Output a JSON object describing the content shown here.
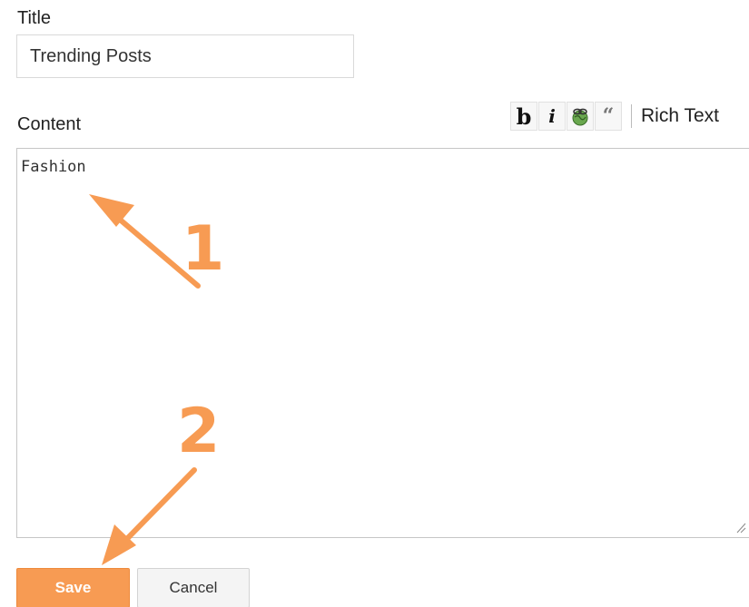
{
  "form": {
    "title_label": "Title",
    "title_value": "Trending Posts",
    "content_label": "Content",
    "content_value": "Fashion"
  },
  "toolbar": {
    "bold": "b",
    "italic": "i",
    "quote": "“",
    "rich_text": "Rich Text",
    "icons": [
      "bold-icon",
      "italic-icon",
      "link-icon",
      "quote-icon"
    ]
  },
  "buttons": {
    "save": "Save",
    "cancel": "Cancel"
  },
  "annotations": {
    "step1": "1",
    "step2": "2"
  },
  "colors": {
    "accent": "#f79b53",
    "save_border": "#ee8a3c",
    "border": "#c6c6c6"
  }
}
